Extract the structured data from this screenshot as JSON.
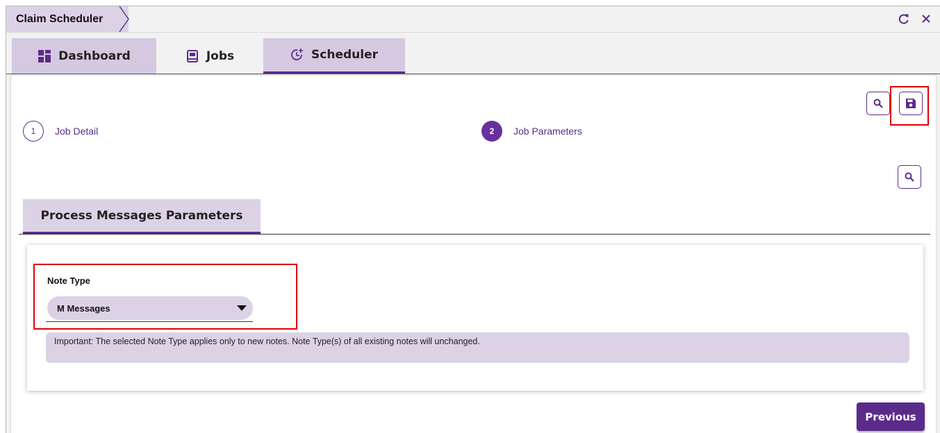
{
  "window": {
    "title": "Claim Scheduler",
    "refresh_icon": "refresh-icon",
    "close_icon": "close-icon"
  },
  "tabs": [
    {
      "label": "Dashboard",
      "icon": "dashboard-icon"
    },
    {
      "label": "Jobs",
      "icon": "jobs-icon"
    },
    {
      "label": "Scheduler",
      "icon": "scheduler-icon",
      "selected": true
    }
  ],
  "toolbar": {
    "search_icon": "search-icon",
    "save_icon": "save-icon",
    "secondary_search_icon": "search-icon"
  },
  "stepper": [
    {
      "number": "1",
      "label": "Job Detail",
      "active": false
    },
    {
      "number": "2",
      "label": "Job Parameters",
      "active": true
    }
  ],
  "subtab": {
    "label": "Process Messages Parameters"
  },
  "form": {
    "note_type_label": "Note Type",
    "note_type_value": "M Messages",
    "note_text": "Important: The selected Note Type applies only to new notes. Note Type(s) of all existing notes will unchanged."
  },
  "footer": {
    "previous_label": "Previous"
  },
  "colors": {
    "accent": "#5b2b8c",
    "accent_light": "#dcd2e6",
    "highlight": "#e00000"
  }
}
